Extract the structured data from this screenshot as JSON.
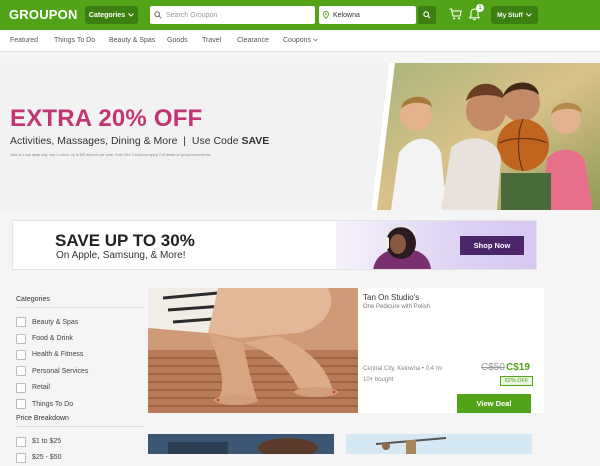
{
  "header": {
    "logo": "GROUPON",
    "categories_label": "Categories",
    "search_placeholder": "Search Groupon",
    "location_value": "Kelowna",
    "notification_count": "1",
    "mystuff_label": "My Stuff"
  },
  "nav": [
    "Featured",
    "Things To Do",
    "Beauty & Spas",
    "Goods",
    "Travel",
    "Clearance",
    "Coupons"
  ],
  "hero": {
    "headline": "EXTRA 20% OFF",
    "subline_pre": "Activities, Massages, Dining & More  |  Use Code ",
    "code": "SAVE",
    "fine_print": "Valid on Local deals only, max 2 orders. Up to $30 discount per order. Ends 9/16. Exclusions apply. Full details on groupon.com/terms."
  },
  "promo": {
    "headline": "SAVE UP TO 30%",
    "subline": "On Apple, Samsung, & More!",
    "button": "Shop Now"
  },
  "sidebar": {
    "categories_title": "Categories",
    "categories": [
      "Beauty & Spas",
      "Food & Drink",
      "Health & Fitness",
      "Personal Services",
      "Retail",
      "Things To Do"
    ],
    "price_title": "Price Breakdown",
    "price_options": [
      "$1 to $25",
      "$25 - $50"
    ]
  },
  "deal": {
    "title": "Tan On Studio's",
    "subtitle": "One Pedicure with Polish",
    "location": "Central City, Kelowna • 0.4 mi",
    "bought": "10+ bought",
    "old_price": "C$50",
    "new_price": "C$19",
    "discount": "62% OFF",
    "button": "View Deal"
  },
  "colors": {
    "brand_green": "#53a318",
    "dark_green": "#3d7f10",
    "hero_pink": "#c33572",
    "promo_purple": "#4b2769"
  }
}
